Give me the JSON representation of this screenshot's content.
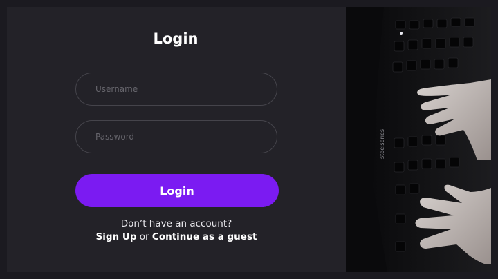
{
  "login": {
    "title": "Login",
    "username_placeholder": "Username",
    "password_placeholder": "Password",
    "button_label": "Login",
    "no_account_text": "Don’t have an account?",
    "sign_up_link": "Sign Up",
    "or_text": "or",
    "guest_link": "Continue as a guest"
  },
  "photo": {
    "keyboard_brand": "steelseries"
  },
  "colors": {
    "accent": "#7b1bf2",
    "panel_bg": "#232228",
    "field_border": "#45444b"
  }
}
